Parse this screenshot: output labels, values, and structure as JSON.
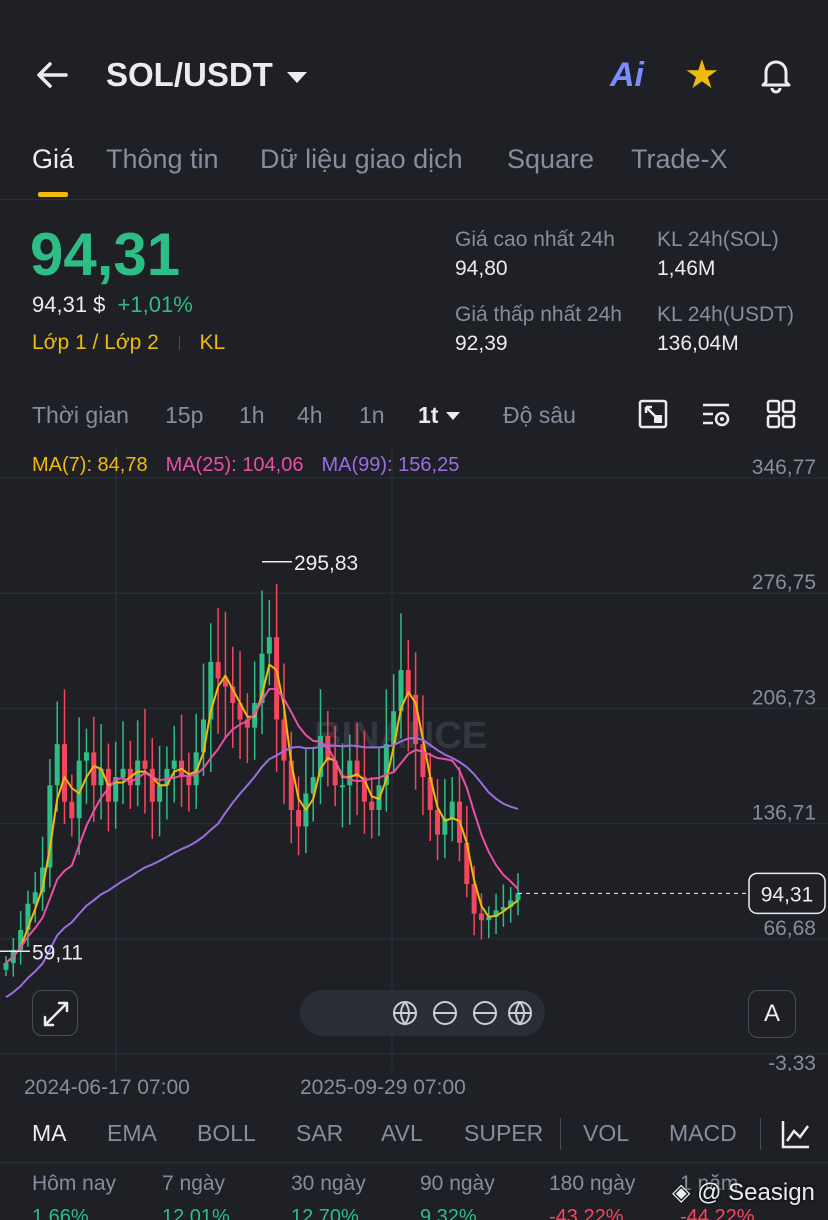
{
  "header": {
    "pair": "SOL/USDT",
    "ai_label": "Ai"
  },
  "tabs": [
    "Giá",
    "Thông tin",
    "Dữ liệu giao dịch",
    "Square",
    "Trade-X"
  ],
  "price": {
    "last": "94,31",
    "fiat": "94,31 $",
    "change": "+1,01%",
    "layer": "Lớp 1 / Lớp 2",
    "kl": "KL"
  },
  "stats": {
    "high_label": "Giá cao nhất 24h",
    "high_value": "94,80",
    "low_label": "Giá thấp nhất 24h",
    "low_value": "92,39",
    "vol_sol_label": "KL 24h(SOL)",
    "vol_sol_value": "1,46M",
    "vol_usdt_label": "KL 24h(USDT)",
    "vol_usdt_value": "136,04M"
  },
  "timeframes": [
    "Thời gian",
    "15p",
    "1h",
    "4h",
    "1n",
    "1t",
    "Độ sâu"
  ],
  "active_timeframe": "1t",
  "ma_legend": {
    "ma7": "MA(7): 84,78",
    "ma25": "MA(25): 104,06",
    "ma99": "MA(99): 156,25"
  },
  "colors": {
    "up": "#2ebd85",
    "down": "#f6465d",
    "accent": "#f0b90b",
    "ma7": "#f0b90b",
    "ma25": "#e84fa6",
    "ma99": "#9b6de0"
  },
  "chart_data": {
    "type": "candlestick",
    "y_axis_labels": [
      "346,77",
      "276,75",
      "206,73",
      "136,71",
      "66,68",
      "-3,33"
    ],
    "ylim": [
      -3.33,
      346.77
    ],
    "x_axis_labels": [
      "2024-06-17 07:00",
      "2025-09-29 07:00"
    ],
    "current_price_label": "94,31",
    "high_label": "295,83",
    "low_label": "59,11",
    "watermark": "BINANCE",
    "closes": [
      52,
      60,
      72,
      88,
      95,
      110,
      160,
      185,
      150,
      140,
      175,
      180,
      160,
      170,
      150,
      165,
      170,
      160,
      175,
      170,
      150,
      160,
      170,
      175,
      165,
      160,
      180,
      200,
      235,
      225,
      220,
      210,
      200,
      195,
      210,
      240,
      250,
      200,
      175,
      145,
      135,
      155,
      165,
      190,
      175,
      160,
      160,
      175,
      165,
      150,
      145,
      160,
      185,
      205,
      230,
      215,
      185,
      165,
      145,
      130,
      140,
      150,
      125,
      100,
      82,
      78,
      80,
      84,
      86,
      90,
      94.31
    ],
    "series": [
      {
        "name": "MA(7)",
        "last": 84.78
      },
      {
        "name": "MA(25)",
        "last": 104.06
      },
      {
        "name": "MA(99)",
        "last": 156.25
      }
    ]
  },
  "indicators": [
    "MA",
    "EMA",
    "BOLL",
    "SAR",
    "AVL",
    "SUPER",
    "VOL",
    "MACD"
  ],
  "active_indicator": "MA",
  "performance": [
    {
      "label": "Hôm nay",
      "value": "1,66%"
    },
    {
      "label": "7 ngày",
      "value": "12,01%"
    },
    {
      "label": "30 ngày",
      "value": "12,70%"
    },
    {
      "label": "90 ngày",
      "value": "9,32%"
    },
    {
      "label": "180 ngày",
      "value": "-43,22%"
    },
    {
      "label": "1 năm",
      "value": "-44,22%"
    }
  ],
  "watermark_user": "@ Seasign",
  "auto_button": "A"
}
